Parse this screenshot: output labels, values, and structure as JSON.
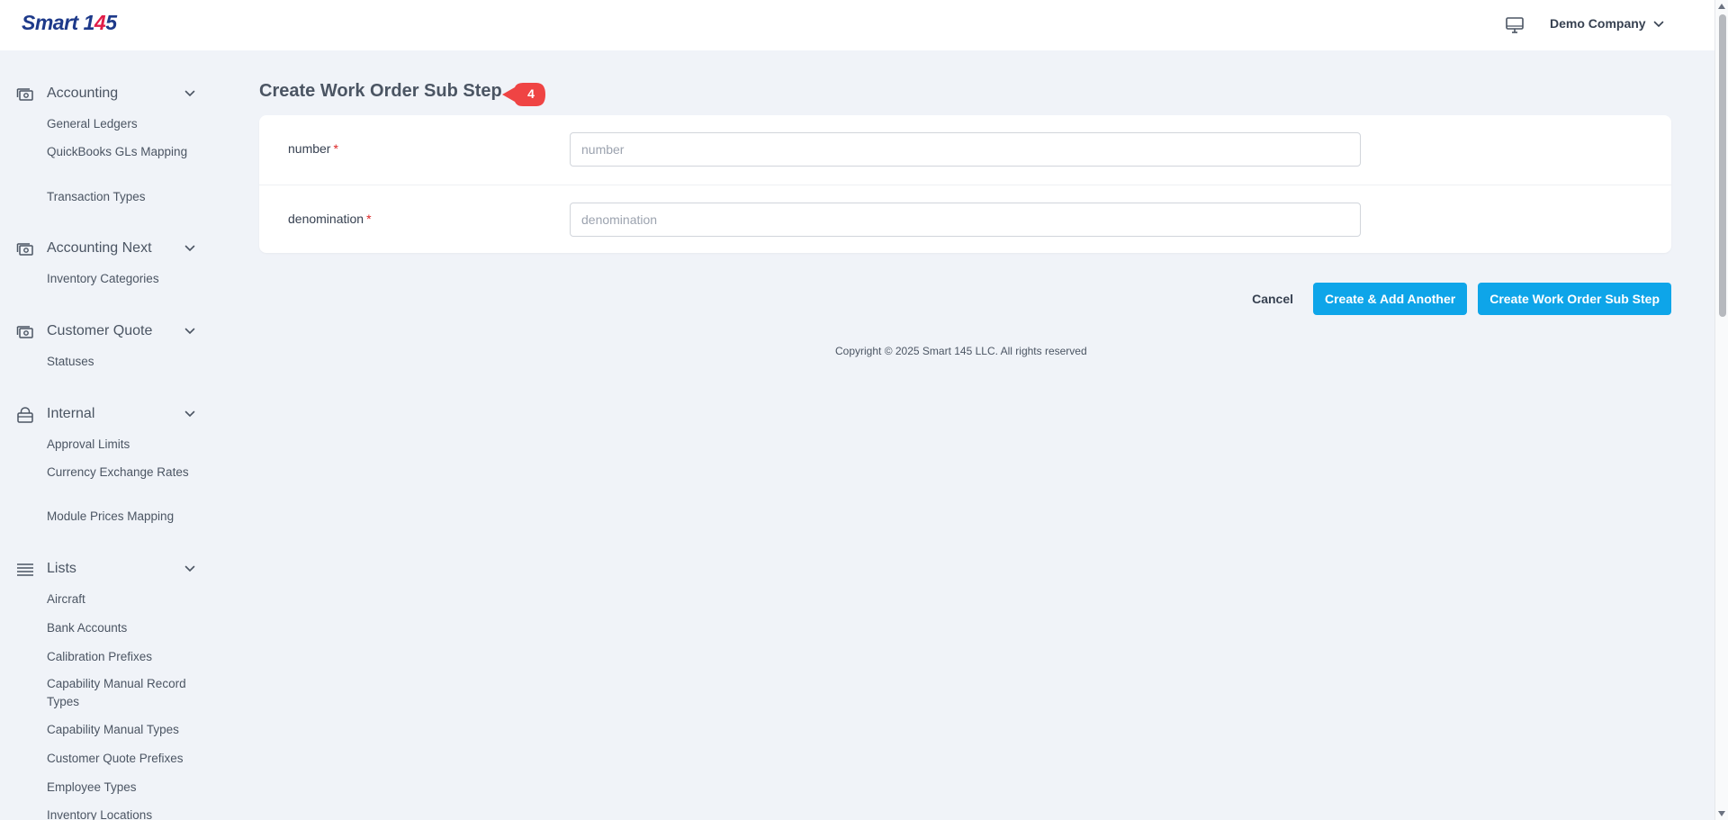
{
  "header": {
    "logo_text": "Smart ",
    "logo_num_a": "1",
    "logo_num_red": "4",
    "logo_num_b": "5",
    "company": "Demo Company",
    "monitor_icon": "monitor-icon"
  },
  "sidebar": {
    "groups": [
      {
        "label": "Accounting",
        "icon": "money-icon",
        "items": [
          "General Ledgers",
          "QuickBooks GLs Mapping",
          "Transaction Types"
        ]
      },
      {
        "label": "Accounting Next",
        "icon": "money-icon",
        "items": [
          "Inventory Categories"
        ]
      },
      {
        "label": "Customer Quote",
        "icon": "money-icon",
        "items": [
          "Statuses"
        ]
      },
      {
        "label": "Internal",
        "icon": "lock-icon",
        "items": [
          "Approval Limits",
          "Currency Exchange Rates",
          "Module Prices Mapping"
        ]
      },
      {
        "label": "Lists",
        "icon": "list-icon",
        "items": [
          "Aircraft",
          "Bank Accounts",
          "Calibration Prefixes",
          "Capability Manual Record Types",
          "Capability Manual Types",
          "Customer Quote Prefixes",
          "Employee Types",
          "Inventory Locations"
        ]
      }
    ]
  },
  "main": {
    "title": "Create Work Order Sub Step",
    "step_badge": "4",
    "fields": [
      {
        "label": "number",
        "required_mark": "*",
        "placeholder": "number",
        "value": ""
      },
      {
        "label": "denomination",
        "required_mark": "*",
        "placeholder": "denomination",
        "value": ""
      }
    ],
    "actions": {
      "cancel": "Cancel",
      "create_add_another": "Create & Add Another",
      "create": "Create Work Order Sub Step"
    },
    "copyright": "Copyright © 2025 Smart 145 LLC. All rights reserved"
  },
  "colors": {
    "primary": "#0ea5e9",
    "badge": "#ef4444",
    "required": "#dc2626",
    "logo_blue": "#1e3a8a",
    "logo_red": "#e11d48"
  }
}
